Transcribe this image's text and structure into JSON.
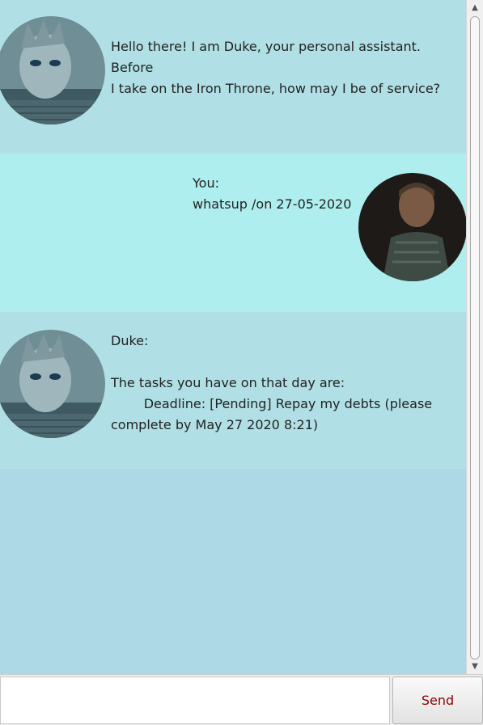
{
  "messages": [
    {
      "sender": "duke",
      "text": "Hello there! I am Duke, your personal assistant. Before\nI take on the Iron Throne, how may I be of service?"
    },
    {
      "sender": "user",
      "text": "You:\nwhatsup /on 27-05-2020"
    },
    {
      "sender": "duke",
      "text": "Duke:\n\nThe tasks you have on that day are:\n        Deadline: [Pending] Repay my debts (please\ncomplete by May 27 2020 8:21)"
    }
  ],
  "input": {
    "value": "",
    "placeholder": ""
  },
  "send_button": {
    "label": "Send"
  },
  "colors": {
    "chat_background": "#add8e6",
    "duke_bubble": "#b0e0e6",
    "user_bubble": "#afeeee",
    "send_text": "#8b0000"
  },
  "icons": {
    "scroll_up": "triangle-up-icon",
    "scroll_down": "triangle-down-icon"
  }
}
